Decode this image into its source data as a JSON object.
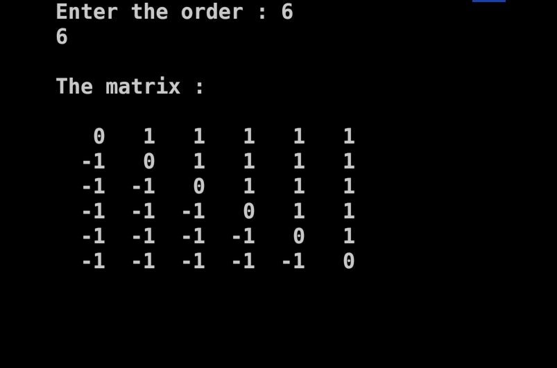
{
  "console": {
    "prompt": "Enter the order : ",
    "prompt_value": "6",
    "echo": "6",
    "matrix_title": "The matrix :",
    "matrix": [
      [
        "0",
        "1",
        "1",
        "1",
        "1",
        "1"
      ],
      [
        "-1",
        "0",
        "1",
        "1",
        "1",
        "1"
      ],
      [
        "-1",
        "-1",
        "0",
        "1",
        "1",
        "1"
      ],
      [
        "-1",
        "-1",
        "-1",
        "0",
        "1",
        "1"
      ],
      [
        "-1",
        "-1",
        "-1",
        "-1",
        "0",
        "1"
      ],
      [
        "-1",
        "-1",
        "-1",
        "-1",
        "-1",
        "0"
      ]
    ]
  },
  "colors": {
    "background": "#000000",
    "text": "#c8c8c8",
    "accent_strip": "#1d3fa8"
  }
}
